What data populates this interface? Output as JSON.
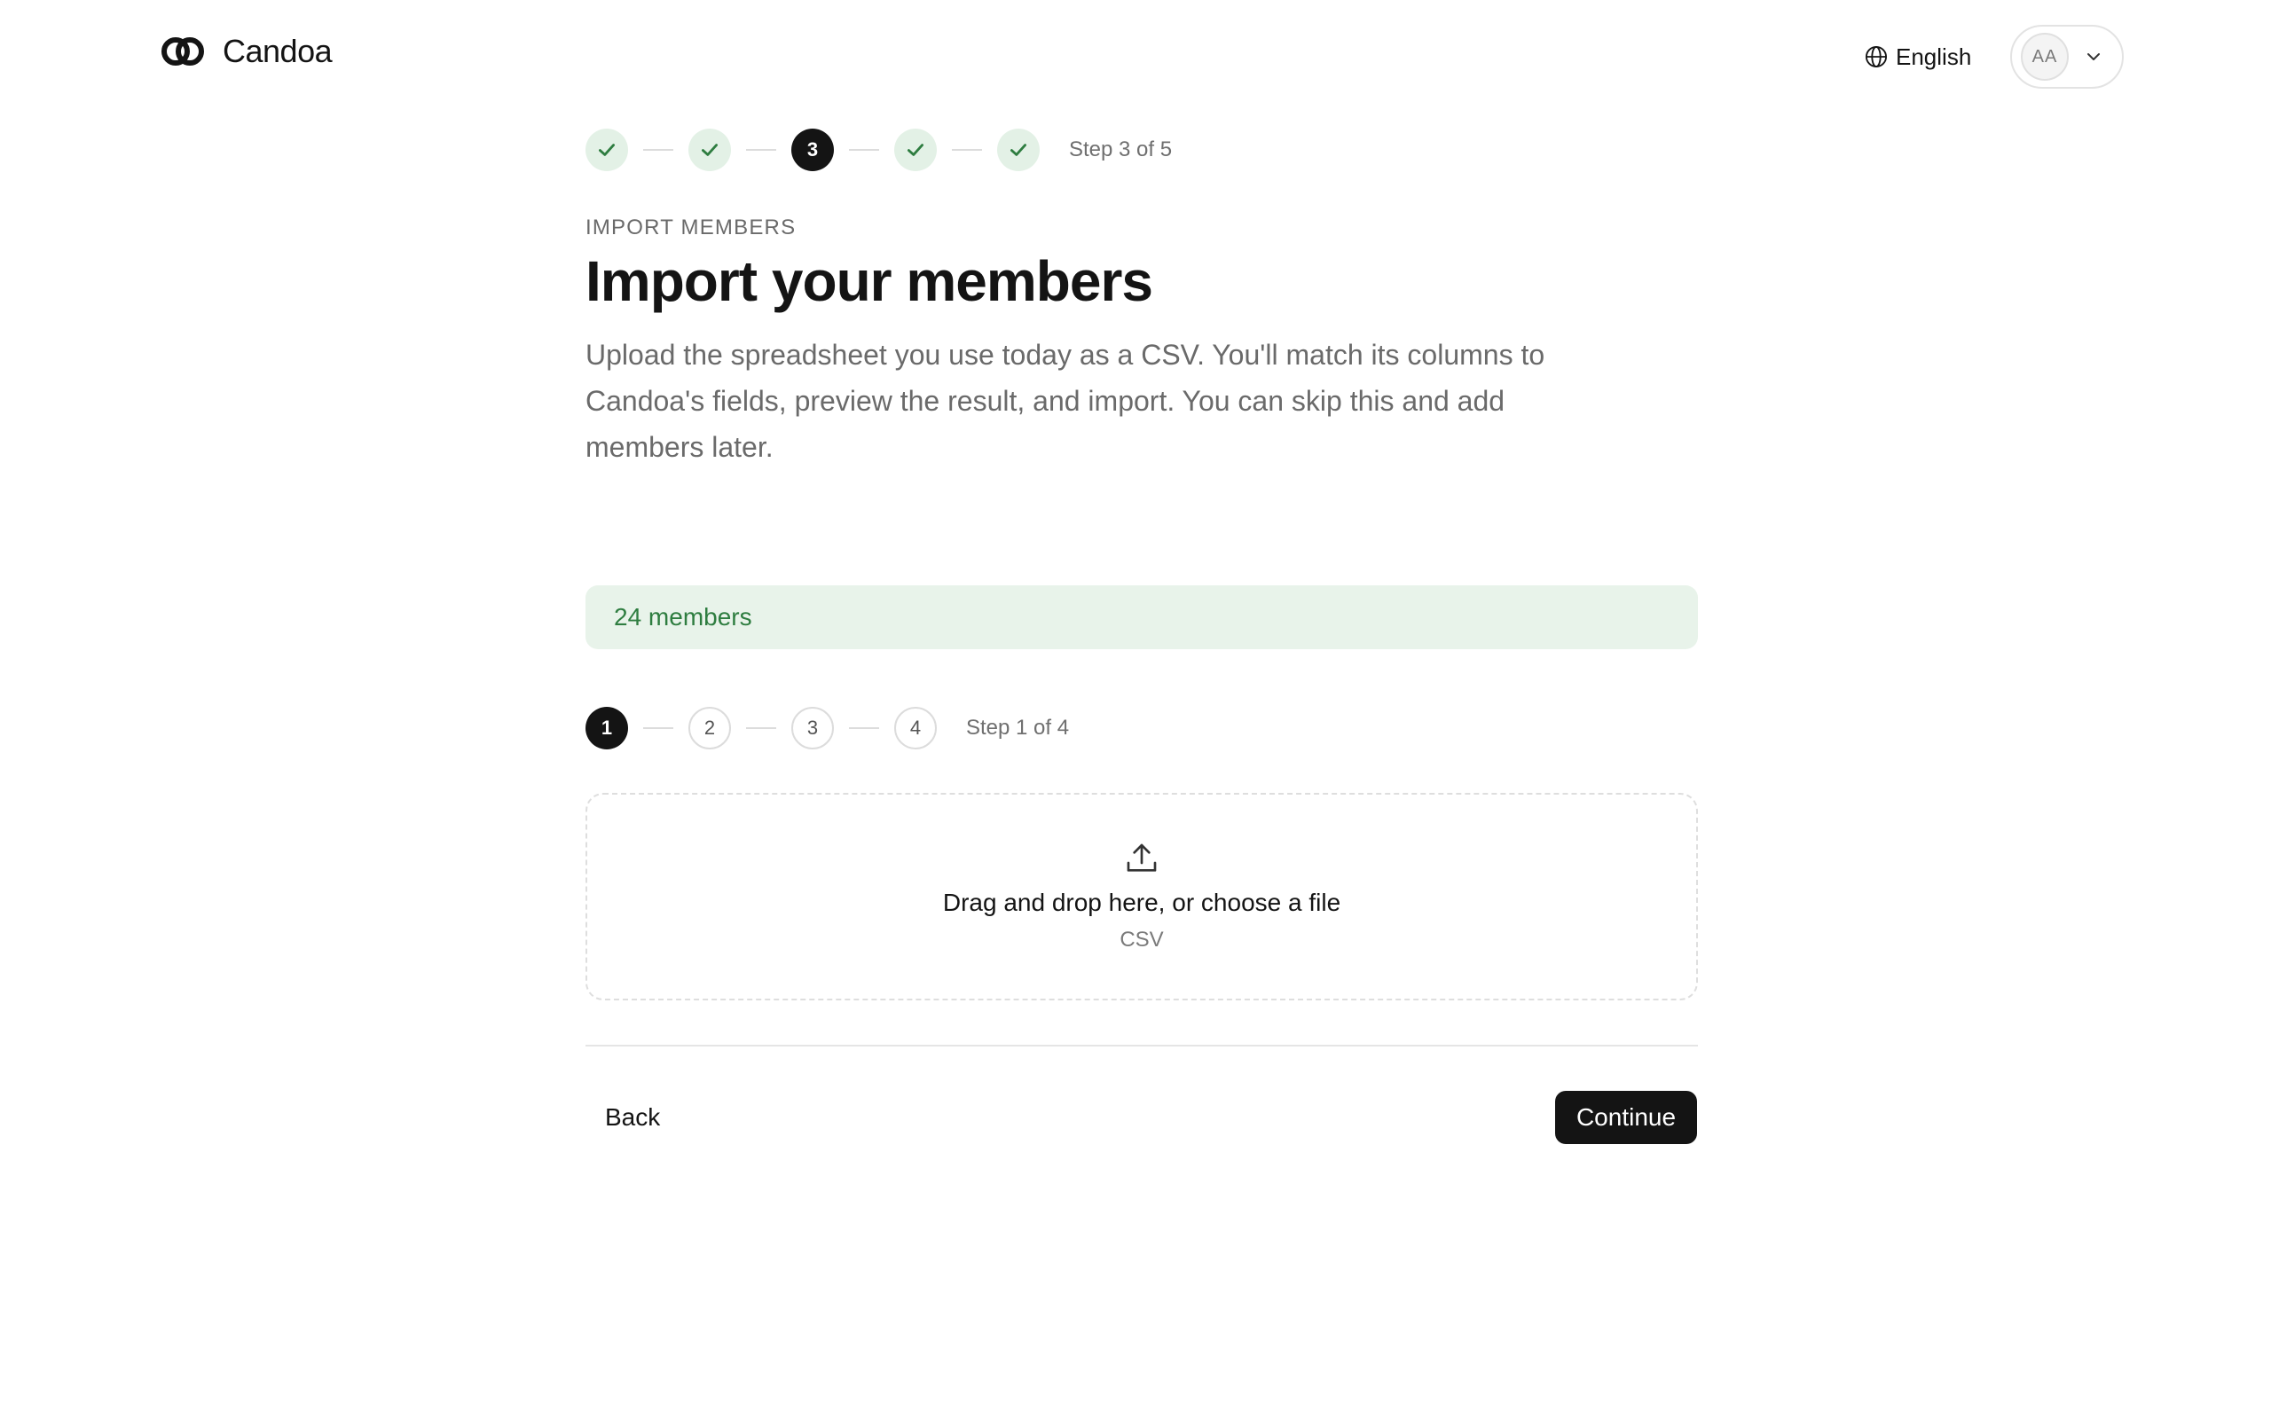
{
  "header": {
    "brand_name": "Candoa",
    "language_label": "English",
    "avatar_initials": "AA"
  },
  "outer_stepper": {
    "steps": [
      {
        "state": "done",
        "label": ""
      },
      {
        "state": "done",
        "label": ""
      },
      {
        "state": "current",
        "label": "3"
      },
      {
        "state": "done",
        "label": ""
      },
      {
        "state": "done",
        "label": ""
      }
    ],
    "status_text": "Step 3 of 5"
  },
  "page": {
    "eyebrow": "IMPORT MEMBERS",
    "title": "Import your members",
    "description": "Upload the spreadsheet you use today as a CSV. You'll match its columns to Candoa's fields, preview the result, and import. You can skip this and add members later."
  },
  "members_banner": {
    "text": "24 members"
  },
  "inner_stepper": {
    "steps": [
      {
        "state": "current",
        "label": "1"
      },
      {
        "state": "pending",
        "label": "2"
      },
      {
        "state": "pending",
        "label": "3"
      },
      {
        "state": "pending",
        "label": "4"
      }
    ],
    "status_text": "Step 1 of 4"
  },
  "dropzone": {
    "prompt_prefix": "Drag and drop here, or ",
    "choose_link": "choose a file",
    "accepted_types": "CSV"
  },
  "footer": {
    "back_label": "Back",
    "continue_label": "Continue"
  },
  "colors": {
    "accent_dark": "#141414",
    "success_bg": "#e8f3ea",
    "success_text": "#2e7d40",
    "check_green": "#2e7d40"
  }
}
